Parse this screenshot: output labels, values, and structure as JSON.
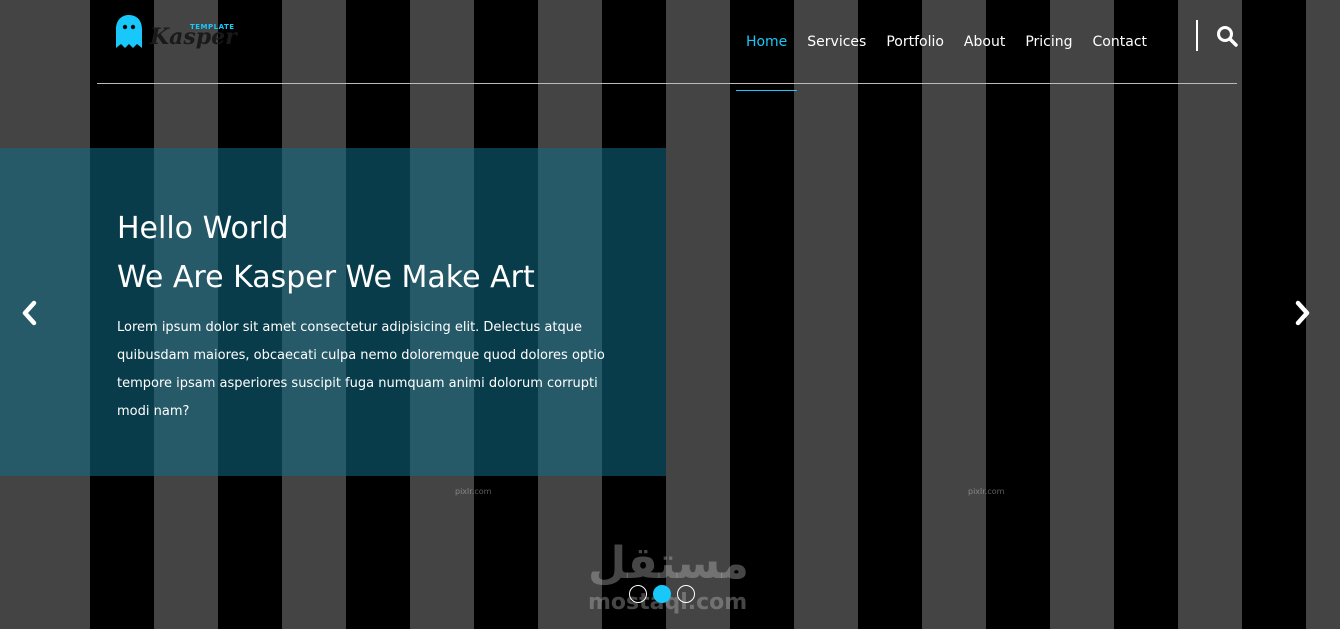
{
  "brand": {
    "name": "Kasper",
    "tagline": "TEMPLATE",
    "accent_color": "#19c8fa"
  },
  "nav": {
    "items": [
      {
        "label": "Home",
        "active": true
      },
      {
        "label": "Services",
        "active": false
      },
      {
        "label": "Portfolio",
        "active": false
      },
      {
        "label": "About",
        "active": false
      },
      {
        "label": "Pricing",
        "active": false
      },
      {
        "label": "Contact",
        "active": false
      }
    ],
    "search_icon": "search-icon"
  },
  "hero": {
    "title_line1": "Hello World",
    "title_line2": "We Are Kasper We Make Art",
    "text": "Lorem ipsum dolor sit amet consectetur adipisicing elit. Delectus atque quibusdam maiores, obcaecati culpa nemo doloremque quod dolores optio tempore ipsam asperiores suscipit fuga numquam animi dolorum corrupti modi nam?"
  },
  "slider": {
    "prev_icon": "chevron-left-icon",
    "next_icon": "chevron-right-icon",
    "bullets": [
      {
        "active": false
      },
      {
        "active": true
      },
      {
        "active": false
      }
    ]
  },
  "watermark": {
    "small_left": "pixlr.com",
    "small_right": "pixlr.com",
    "arabic": "مستقل",
    "latin": "mostaql.com"
  }
}
